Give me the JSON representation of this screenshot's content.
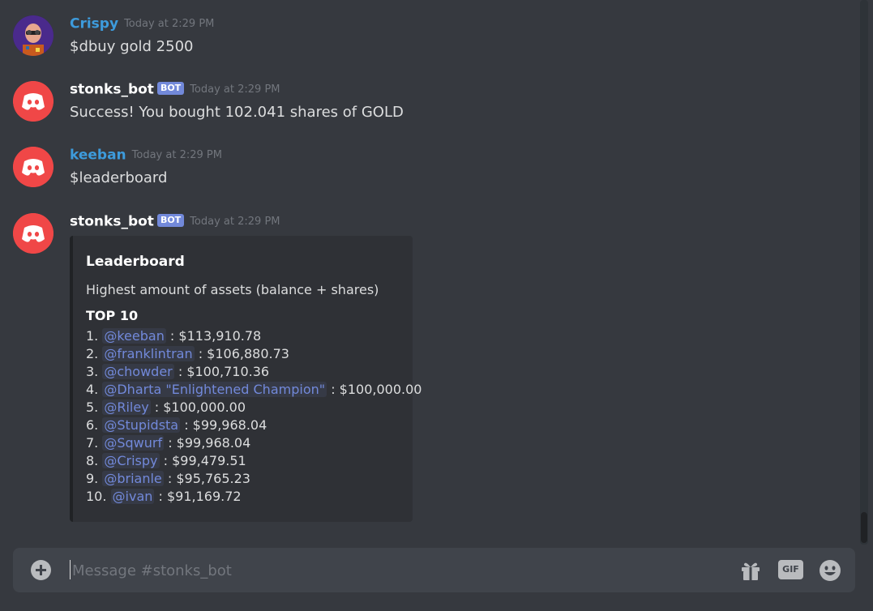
{
  "messages": [
    {
      "username": "Crispy",
      "timestamp": "Today at 2:29 PM",
      "text": "$dbuy gold 2500"
    },
    {
      "username": "stonks_bot",
      "bot_tag": "BOT",
      "timestamp": "Today at 2:29 PM",
      "text": "Success! You bought 102.041 shares of GOLD"
    },
    {
      "username": "keeban",
      "timestamp": "Today at 2:29 PM",
      "text": "$leaderboard"
    },
    {
      "username": "stonks_bot",
      "bot_tag": "BOT",
      "timestamp": "Today at 2:29 PM",
      "embed": {
        "title": "Leaderboard",
        "description": "Highest amount of assets (balance + shares)",
        "field_name": "TOP 10",
        "entries": [
          {
            "rank": "1.",
            "mention": "@keeban",
            "value": " : $113,910.78"
          },
          {
            "rank": "2.",
            "mention": "@franklintran",
            "value": " : $106,880.73"
          },
          {
            "rank": "3.",
            "mention": "@chowder",
            "value": " : $100,710.36"
          },
          {
            "rank": "4.",
            "mention": "@Dharta \"Enlightened Champion\"",
            "value": " : $100,000.00"
          },
          {
            "rank": "5.",
            "mention": "@Riley",
            "value": " : $100,000.00"
          },
          {
            "rank": "6.",
            "mention": "@Stupidsta",
            "value": " : $99,968.04"
          },
          {
            "rank": "7.",
            "mention": "@Sqwurf",
            "value": " : $99,968.04"
          },
          {
            "rank": "8.",
            "mention": "@Crispy",
            "value": " : $99,479.51"
          },
          {
            "rank": "9.",
            "mention": "@brianle",
            "value": " : $95,765.23"
          },
          {
            "rank": "10.",
            "mention": "@ivan",
            "value": " : $91,169.72"
          }
        ]
      }
    }
  ],
  "composer": {
    "placeholder": "Message #stonks_bot",
    "gif_label": "GIF"
  },
  "icons": {
    "attach": "plus-circle-icon",
    "gift": "gift-icon",
    "gif": "gif-icon",
    "emoji": "emoji-smile-icon",
    "bot_avatar": "discord-logo-icon"
  },
  "colors": {
    "background": "#36393f",
    "username_blue": "#3d9bdc",
    "bot_tag": "#7289da",
    "avatar_red": "#f04747",
    "mention": "#7289da",
    "embed_bg": "#2f3136"
  }
}
